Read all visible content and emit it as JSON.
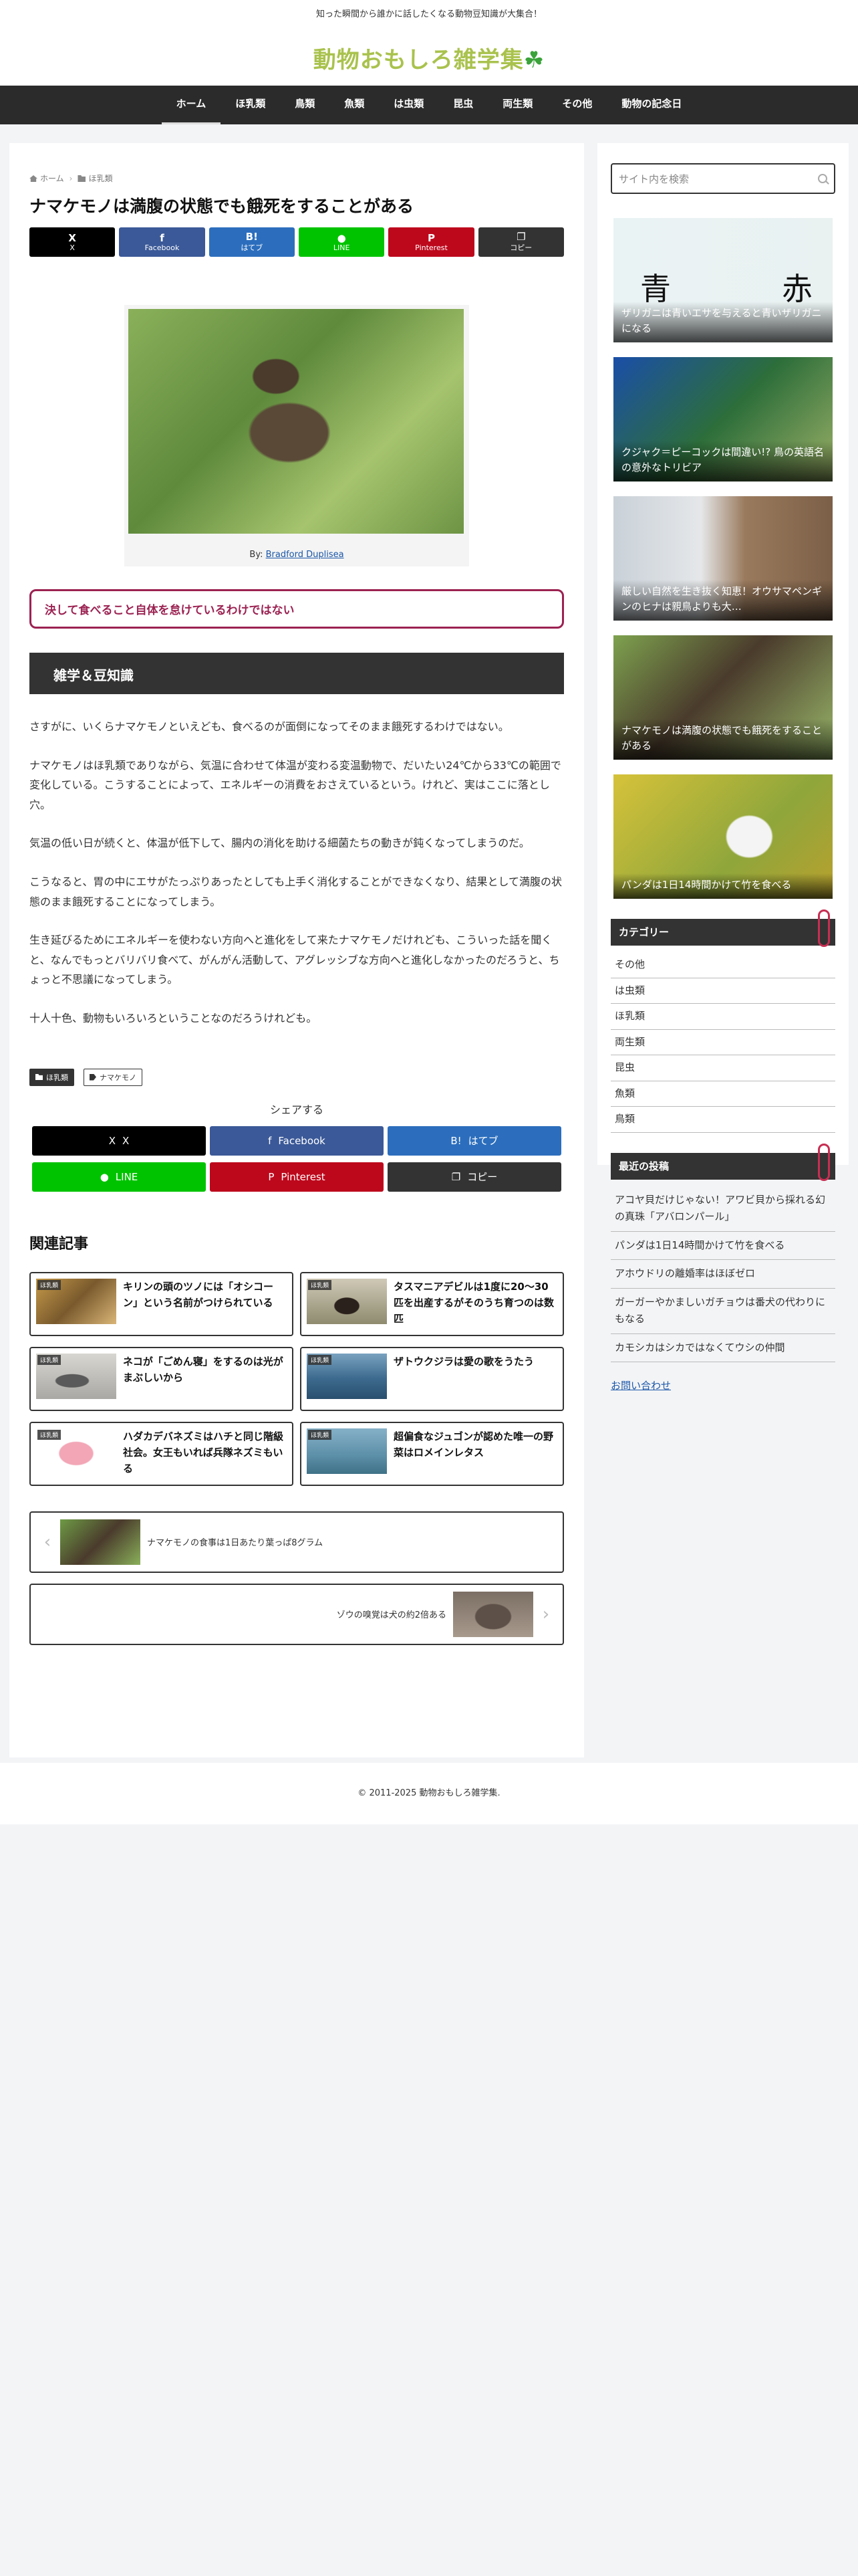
{
  "site": {
    "tagline": "知った瞬間から誰かに話したくなる動物豆知識が大集合！",
    "logo": "動物おもしろ雑学集",
    "logo_mark": "☘"
  },
  "nav": [
    "ホーム",
    "ほ乳類",
    "鳥類",
    "魚類",
    "は虫類",
    "昆虫",
    "両生類",
    "その他",
    "動物の記念日"
  ],
  "breadcrumb": {
    "home": "ホーム",
    "category": "ほ乳類"
  },
  "article": {
    "title": "ナマケモノは満腹の状態でも餓死をすることがある",
    "share_top": [
      {
        "icon": "X",
        "label": "X"
      },
      {
        "icon": "f",
        "label": "Facebook"
      },
      {
        "icon": "B!",
        "label": "はてブ"
      },
      {
        "icon": "●",
        "label": "LINE"
      },
      {
        "icon": "P",
        "label": "Pinterest"
      },
      {
        "icon": "❐",
        "label": "コピー"
      }
    ],
    "caption_prefix": "By: ",
    "caption_link": "Bradford Duplisea",
    "callout": "決して食べること自体を怠けているわけではない",
    "section": "雑学＆豆知識",
    "paragraphs": [
      "さすがに、いくらナマケモノといえども、食べるのが面倒になってそのまま餓死するわけではない。",
      "ナマケモノはほ乳類でありながら、気温に合わせて体温が変わる変温動物で、だいたい24℃から33℃の範囲で変化している。こうすることによって、エネルギーの消費をおさえているという。けれど、実はここに落とし穴。",
      "気温の低い日が続くと、体温が低下して、腸内の消化を助ける細菌たちの動きが鈍くなってしまうのだ。",
      "こうなると、胃の中にエサがたっぷりあったとしても上手く消化することができなくなり、結果として満腹の状態のまま餓死することになってしまう。",
      "生き延びるためにエネルギーを使わない方向へと進化をして来たナマケモノだけれども、こういった話を聞くと、なんでもっとバリバリ食べて、がんがん活動して、アグレッシブな方向へと進化しなかったのだろうと、ちょっと不思議になってしまう。",
      "十人十色、動物もいろいろということなのだろうけれども。"
    ],
    "tags": [
      "ほ乳類",
      "ナマケモノ"
    ],
    "share_title": "シェアする",
    "share_bottom": [
      {
        "icon": "X",
        "label": "X"
      },
      {
        "icon": "f",
        "label": "Facebook"
      },
      {
        "icon": "B!",
        "label": "はてブ"
      },
      {
        "icon": "●",
        "label": "LINE"
      },
      {
        "icon": "P",
        "label": "Pinterest"
      },
      {
        "icon": "❐",
        "label": "コピー"
      }
    ]
  },
  "related": {
    "title": "関連記事",
    "items": [
      {
        "cat": "ほ乳類",
        "text": "キリンの頭のツノには「オシコーン」という名前がつけられている"
      },
      {
        "cat": "ほ乳類",
        "text": "タスマニアデビルは1度に20〜30匹を出産するがそのうち育つのは数匹"
      },
      {
        "cat": "ほ乳類",
        "text": "ネコが「ごめん寝」をするのは光がまぶしいから"
      },
      {
        "cat": "ほ乳類",
        "text": "ザトウクジラは愛の歌をうたう"
      },
      {
        "cat": "ほ乳類",
        "text": "ハダカデバネズミはハチと同じ階級社会。女王もいれば兵隊ネズミもいる"
      },
      {
        "cat": "ほ乳類",
        "text": "超偏食なジュゴンが認めた唯一の野菜はロメインレタス"
      }
    ],
    "prev": "ナマケモノの食事は1日あたり葉っぱ8グラム",
    "next": "ゾウの嗅覚は犬の約2倍ある"
  },
  "sidebar": {
    "search_placeholder": "サイト内を検索",
    "cards": [
      "ザリガニは青いエサを与えると青いザリガニになる",
      "クジャク＝ピーコックは間違い!? 鳥の英語名の意外なトリビア",
      "厳しい自然を生き抜く知恵！オウサマペンギンのヒナは親鳥よりも大…",
      "ナマケモノは満腹の状態でも餓死をすることがある",
      "パンダは1日14時間かけて竹を食べる"
    ],
    "card1_glyphs": [
      "青",
      "赤"
    ],
    "categories_title": "カテゴリー",
    "categories": [
      "その他",
      "は虫類",
      "ほ乳類",
      "両生類",
      "昆虫",
      "魚類",
      "鳥類"
    ],
    "recent_title": "最近の投稿",
    "recent": [
      "アコヤ貝だけじゃない！アワビ貝から採れる幻の真珠「アバロンパール」",
      "パンダは1日14時間かけて竹を食べる",
      "アホウドリの離婚率はほぼゼロ",
      "ガーガーやかましいガチョウは番犬の代わりにもなる",
      "カモシカはシカではなくてウシの仲間"
    ],
    "contact": "お問い合わせ"
  },
  "footer": "© 2011-2025 動物おもしろ雑学集."
}
